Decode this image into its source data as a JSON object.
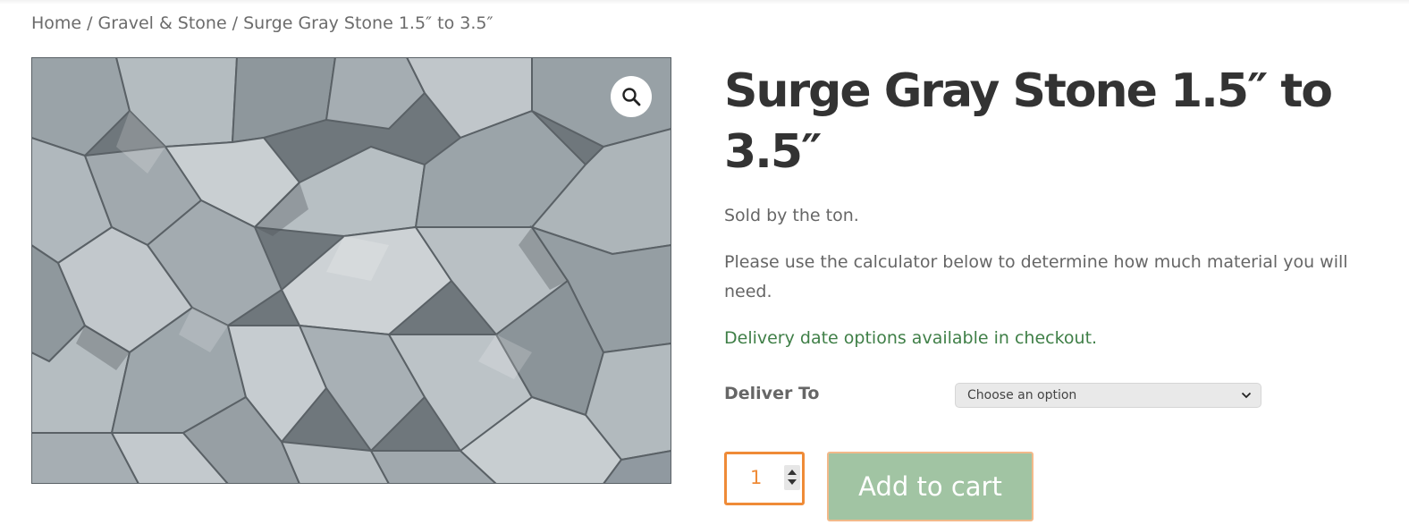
{
  "breadcrumb": {
    "items": [
      "Home",
      "Gravel & Stone",
      "Surge Gray Stone 1.5″ to 3.5″"
    ],
    "separator": "/"
  },
  "product": {
    "title": "Surge Gray Stone 1.5″ to 3.5″",
    "short_description": "Sold by the ton.",
    "calculator_note": "Please use the calculator below to determine how much material you will need.",
    "delivery_note": "Delivery date options available in checkout.",
    "image_alt": "Pile of gray stones",
    "zoom_icon": "magnifier-icon"
  },
  "variation": {
    "label": "Deliver To",
    "select_placeholder": "Choose an option"
  },
  "cart": {
    "quantity": "1",
    "add_to_cart_label": "Add to cart"
  },
  "colors": {
    "accent_orange": "#ef8b37",
    "button_green": "#a1c4a3",
    "delivery_green": "#3f7f47",
    "title_dark": "#333333"
  }
}
